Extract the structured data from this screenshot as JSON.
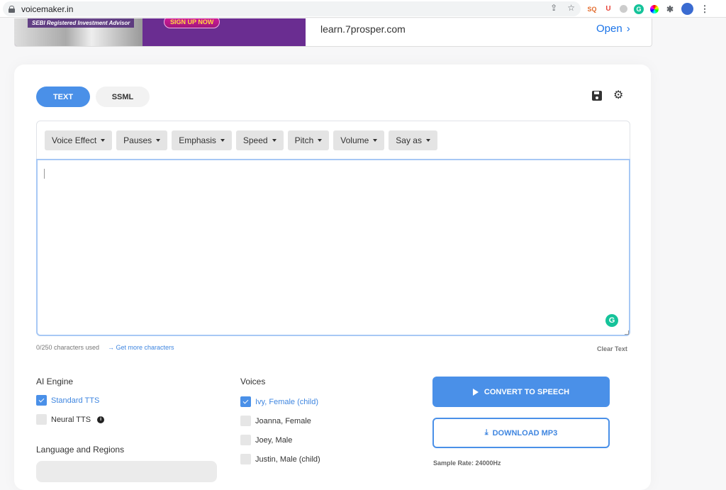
{
  "browser": {
    "url": "voicemaker.in",
    "extensions": [
      "seoquake-icon",
      "ublock-icon",
      "shield-icon",
      "grammarly-icon",
      "color-picker-icon",
      "extensions-puzzle-icon",
      "profile-avatar",
      "menu-icon"
    ],
    "seo_label": "SQ",
    "ublock_label": "U",
    "grammarly_label": "G",
    "puzzle_glyph": "✱",
    "menu_glyph": "⋮",
    "share_glyph": "⇪",
    "star_glyph": "☆"
  },
  "ad": {
    "caption": "SEBI Registered Investment Advisor",
    "cta": "SIGN UP NOW",
    "domain": "learn.7prosper.com",
    "open_label": "Open",
    "open_glyph": "›"
  },
  "mode_tabs": [
    {
      "label": "TEXT",
      "active": true
    },
    {
      "label": "SSML",
      "active": false
    }
  ],
  "icons": {
    "gear_glyph": "⚙"
  },
  "toolbar": [
    {
      "label": "Voice Effect"
    },
    {
      "label": "Pauses"
    },
    {
      "label": "Emphasis"
    },
    {
      "label": "Speed"
    },
    {
      "label": "Pitch"
    },
    {
      "label": "Volume"
    },
    {
      "label": "Say as"
    }
  ],
  "editor": {
    "value": "",
    "grammarly_label": "G",
    "char_count": "0/250 characters used",
    "more_chars": "→ Get more characters",
    "clear_text": "Clear Text"
  },
  "ai_engine": {
    "title": "AI Engine",
    "options": [
      {
        "label": "Standard TTS",
        "checked": true
      },
      {
        "label": "Neural TTS",
        "checked": false,
        "info": "i"
      }
    ]
  },
  "voices": {
    "title": "Voices",
    "options": [
      {
        "label": "Ivy, Female (child)",
        "checked": true
      },
      {
        "label": "Joanna, Female",
        "checked": false
      },
      {
        "label": "Joey, Male",
        "checked": false
      },
      {
        "label": "Justin, Male (child)",
        "checked": false
      }
    ]
  },
  "language": {
    "title": "Language and Regions"
  },
  "actions": {
    "convert_label": "CONVERT TO SPEECH",
    "download_label": "DOWNLOAD MP3",
    "download_glyph": "⤓",
    "sample_rate": "Sample Rate: 24000Hz"
  },
  "colors": {
    "accent": "#4a90e8",
    "link": "#3f86e0",
    "chip": "#e4e4e4",
    "grammarly": "#15c39a",
    "ad_purple": "#6a2d91"
  }
}
